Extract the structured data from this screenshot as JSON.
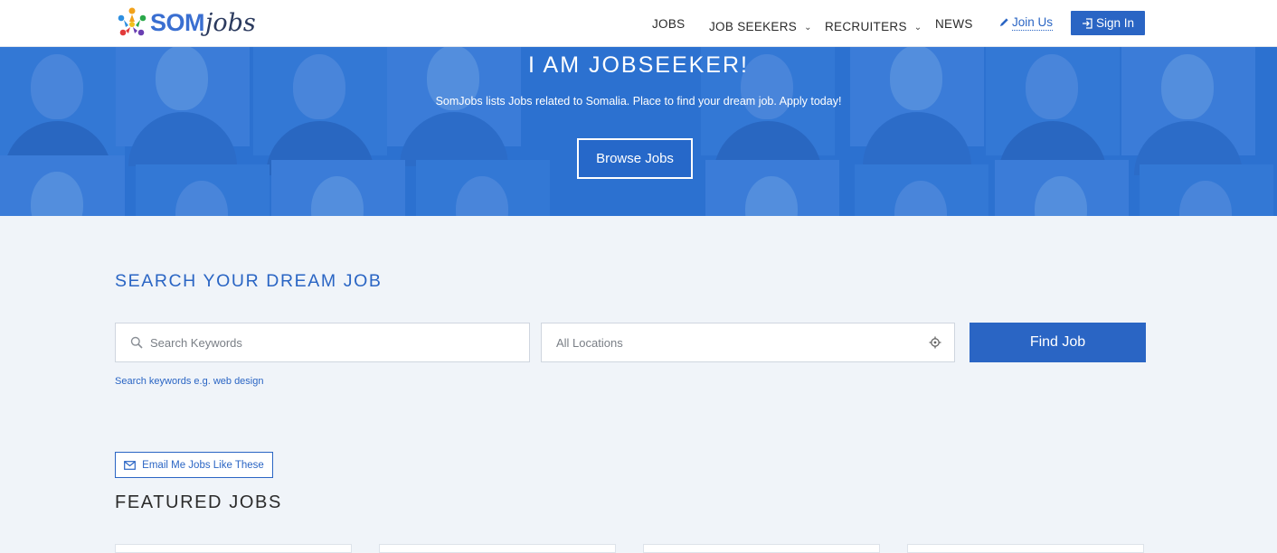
{
  "header": {
    "logo_text_a": "SOM",
    "logo_text_b": "jobs",
    "nav": [
      "JOBS",
      "JOB SEEKERS",
      "RECRUITERS",
      "NEWS"
    ],
    "join_label": "Join Us",
    "signin_label": "Sign In"
  },
  "hero": {
    "title": "I AM JOBSEEKER!",
    "subtitle": "SomJobs lists Jobs related to Somalia. Place to find your dream job. Apply today!",
    "button_label": "Browse Jobs"
  },
  "search": {
    "heading": "SEARCH YOUR DREAM JOB",
    "keywords_placeholder": "Search Keywords",
    "location_placeholder": "All Locations",
    "find_label": "Find Job",
    "hint": "Search keywords e.g. web design"
  },
  "alerts": {
    "email_label": "Email Me Jobs Like These"
  },
  "featured": {
    "heading": "FEATURED JOBS"
  },
  "colors": {
    "brand_blue": "#2a65c4",
    "hero_blue": "#2f73d0",
    "page_bg": "#f0f4f9"
  }
}
